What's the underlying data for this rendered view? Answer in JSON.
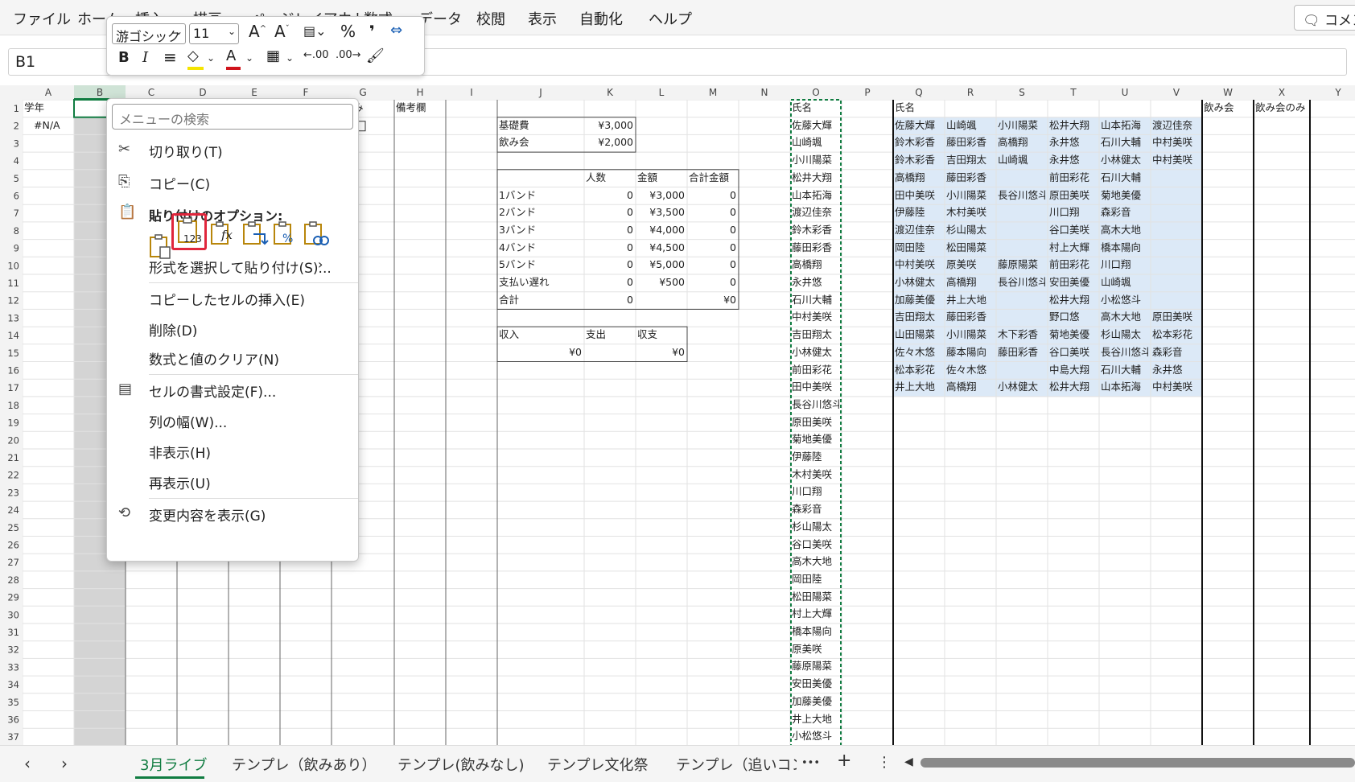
{
  "menubar": {
    "items": [
      "ファイル",
      "ホーム",
      "挿入",
      "描画",
      "ページレイアウト",
      "数式",
      "データ",
      "校閲",
      "表示",
      "自動化",
      "ヘルプ"
    ],
    "comment_label": "コメント"
  },
  "formula": {
    "name_box": "B1",
    "value": ""
  },
  "mini_toolbar": {
    "font_name": "游ゴシック",
    "font_size": "11",
    "bold": "B",
    "italic": "I",
    "percent": "%",
    "comma": "❜",
    "fill_color": "#f5e400",
    "font_color": "#d0141c"
  },
  "context_menu": {
    "search_placeholder": "メニューの検索",
    "cut": "切り取り(T)",
    "copy": "コピー(C)",
    "paste_options": "貼り付けのオプション:",
    "paste_special": "形式を選択して貼り付け(S)...",
    "insert_copied": "コピーしたセルの挿入(E)",
    "delete": "削除(D)",
    "clear": "数式と値のクリア(N)",
    "format_cells": "セルの書式設定(F)...",
    "column_width": "列の幅(W)...",
    "hide": "非表示(H)",
    "unhide": "再表示(U)",
    "show_changes": "変更内容を表示(G)",
    "paste_values_sub": "123",
    "paste_formula_sub": "fx"
  },
  "grid": {
    "columns": [
      "A",
      "B",
      "C",
      "D",
      "E",
      "F",
      "G",
      "H",
      "I",
      "J",
      "K",
      "L",
      "M",
      "N",
      "O",
      "P",
      "Q",
      "R",
      "S",
      "T",
      "U",
      "V",
      "W",
      "X",
      "Y"
    ],
    "rows": [
      1,
      2,
      3,
      4,
      5,
      6,
      7,
      8,
      9,
      10,
      11,
      12,
      13,
      14,
      15,
      16,
      17,
      18,
      19,
      20,
      21,
      22,
      23,
      24,
      25,
      26,
      27,
      28,
      29,
      30,
      31,
      32,
      33,
      34,
      35,
      36,
      37
    ],
    "a1": "学年",
    "a2": "#N/A",
    "g1": "い済み",
    "h1": "備考欄",
    "w1": "飲み会",
    "x1": "飲み会のみ",
    "fees": [
      [
        "基礎費",
        "¥3,000"
      ],
      [
        "飲み会",
        "¥2,000"
      ]
    ],
    "band_table": {
      "headers": [
        "人数",
        "金額",
        "合計金額"
      ],
      "rows": [
        [
          "1バンド",
          "0",
          "¥3,000",
          "0"
        ],
        [
          "2バンド",
          "0",
          "¥3,500",
          "0"
        ],
        [
          "3バンド",
          "0",
          "¥4,000",
          "0"
        ],
        [
          "4バンド",
          "0",
          "¥4,500",
          "0"
        ],
        [
          "5バンド",
          "0",
          "¥5,000",
          "0"
        ],
        [
          "支払い遅れ",
          "0",
          "¥500",
          "0"
        ],
        [
          "合計",
          "0",
          "",
          "¥0"
        ]
      ]
    },
    "income": {
      "headers": [
        "収入",
        "支出",
        "収支"
      ],
      "values": [
        "¥0",
        "",
        "¥0"
      ]
    },
    "o_header": "氏名",
    "o_names": [
      "佐藤大輝",
      "山崎颯",
      "小川陽菜",
      "松井大翔",
      "山本拓海",
      "渡辺佳奈",
      "鈴木彩香",
      "藤田彩香",
      "高橋翔",
      "永井悠",
      "石川大輔",
      "中村美咲",
      "吉田翔太",
      "小林健太",
      "前田彩花",
      "田中美咲",
      "長谷川悠斗",
      "原田美咲",
      "菊地美優",
      "伊藤陸",
      "木村美咲",
      "川口翔",
      "森彩音",
      "杉山陽太",
      "谷口美咲",
      "高木大地",
      "岡田陸",
      "松田陽菜",
      "村上大輝",
      "橋本陽向",
      "原美咲",
      "藤原陽菜",
      "安田美優",
      "加藤美優",
      "井上大地",
      "小松悠斗"
    ],
    "q_header": "氏名",
    "q_rows": [
      [
        "佐藤大輝",
        "山崎颯",
        "小川陽菜",
        "松井大翔",
        "山本拓海",
        "渡辺佳奈"
      ],
      [
        "鈴木彩香",
        "藤田彩香",
        "高橋翔",
        "永井悠",
        "石川大輔",
        "中村美咲"
      ],
      [
        "鈴木彩香",
        "吉田翔太",
        "山崎颯",
        "永井悠",
        "小林健太",
        "中村美咲"
      ],
      [
        "高橋翔",
        "藤田彩香",
        "",
        "前田彩花",
        "石川大輔",
        ""
      ],
      [
        "田中美咲",
        "小川陽菜",
        "長谷川悠斗",
        "原田美咲",
        "菊地美優",
        ""
      ],
      [
        "伊藤陸",
        "木村美咲",
        "",
        "川口翔",
        "森彩音",
        ""
      ],
      [
        "渡辺佳奈",
        "杉山陽太",
        "",
        "谷口美咲",
        "高木大地",
        ""
      ],
      [
        "岡田陸",
        "松田陽菜",
        "",
        "村上大輝",
        "橋本陽向",
        ""
      ],
      [
        "中村美咲",
        "原美咲",
        "藤原陽菜",
        "前田彩花",
        "川口翔",
        ""
      ],
      [
        "小林健太",
        "高橋翔",
        "長谷川悠斗",
        "安田美優",
        "山崎颯",
        ""
      ],
      [
        "加藤美優",
        "井上大地",
        "",
        "松井大翔",
        "小松悠斗",
        ""
      ],
      [
        "吉田翔太",
        "藤田彩香",
        "",
        "野口悠",
        "高木大地",
        "原田美咲"
      ],
      [
        "山田陽菜",
        "小川陽菜",
        "木下彩香",
        "菊地美優",
        "杉山陽太",
        "松本彩花"
      ],
      [
        "佐々木悠",
        "藤本陽向",
        "藤田彩香",
        "谷口美咲",
        "長谷川悠斗",
        "森彩音"
      ],
      [
        "松本彩花",
        "佐々木悠",
        "",
        "中島大翔",
        "石川大輔",
        "永井悠"
      ],
      [
        "井上大地",
        "高橋翔",
        "小林健太",
        "松井大翔",
        "山本拓海",
        "中村美咲"
      ]
    ]
  },
  "tabs": {
    "items": [
      "3月ライブ",
      "テンプレ（飲みあり）",
      "テンプレ(飲みなし)",
      "テンプレ文化祭",
      "テンプレ（追いコン"
    ],
    "more": "•••",
    "add": "+",
    "menu": "⋮"
  }
}
